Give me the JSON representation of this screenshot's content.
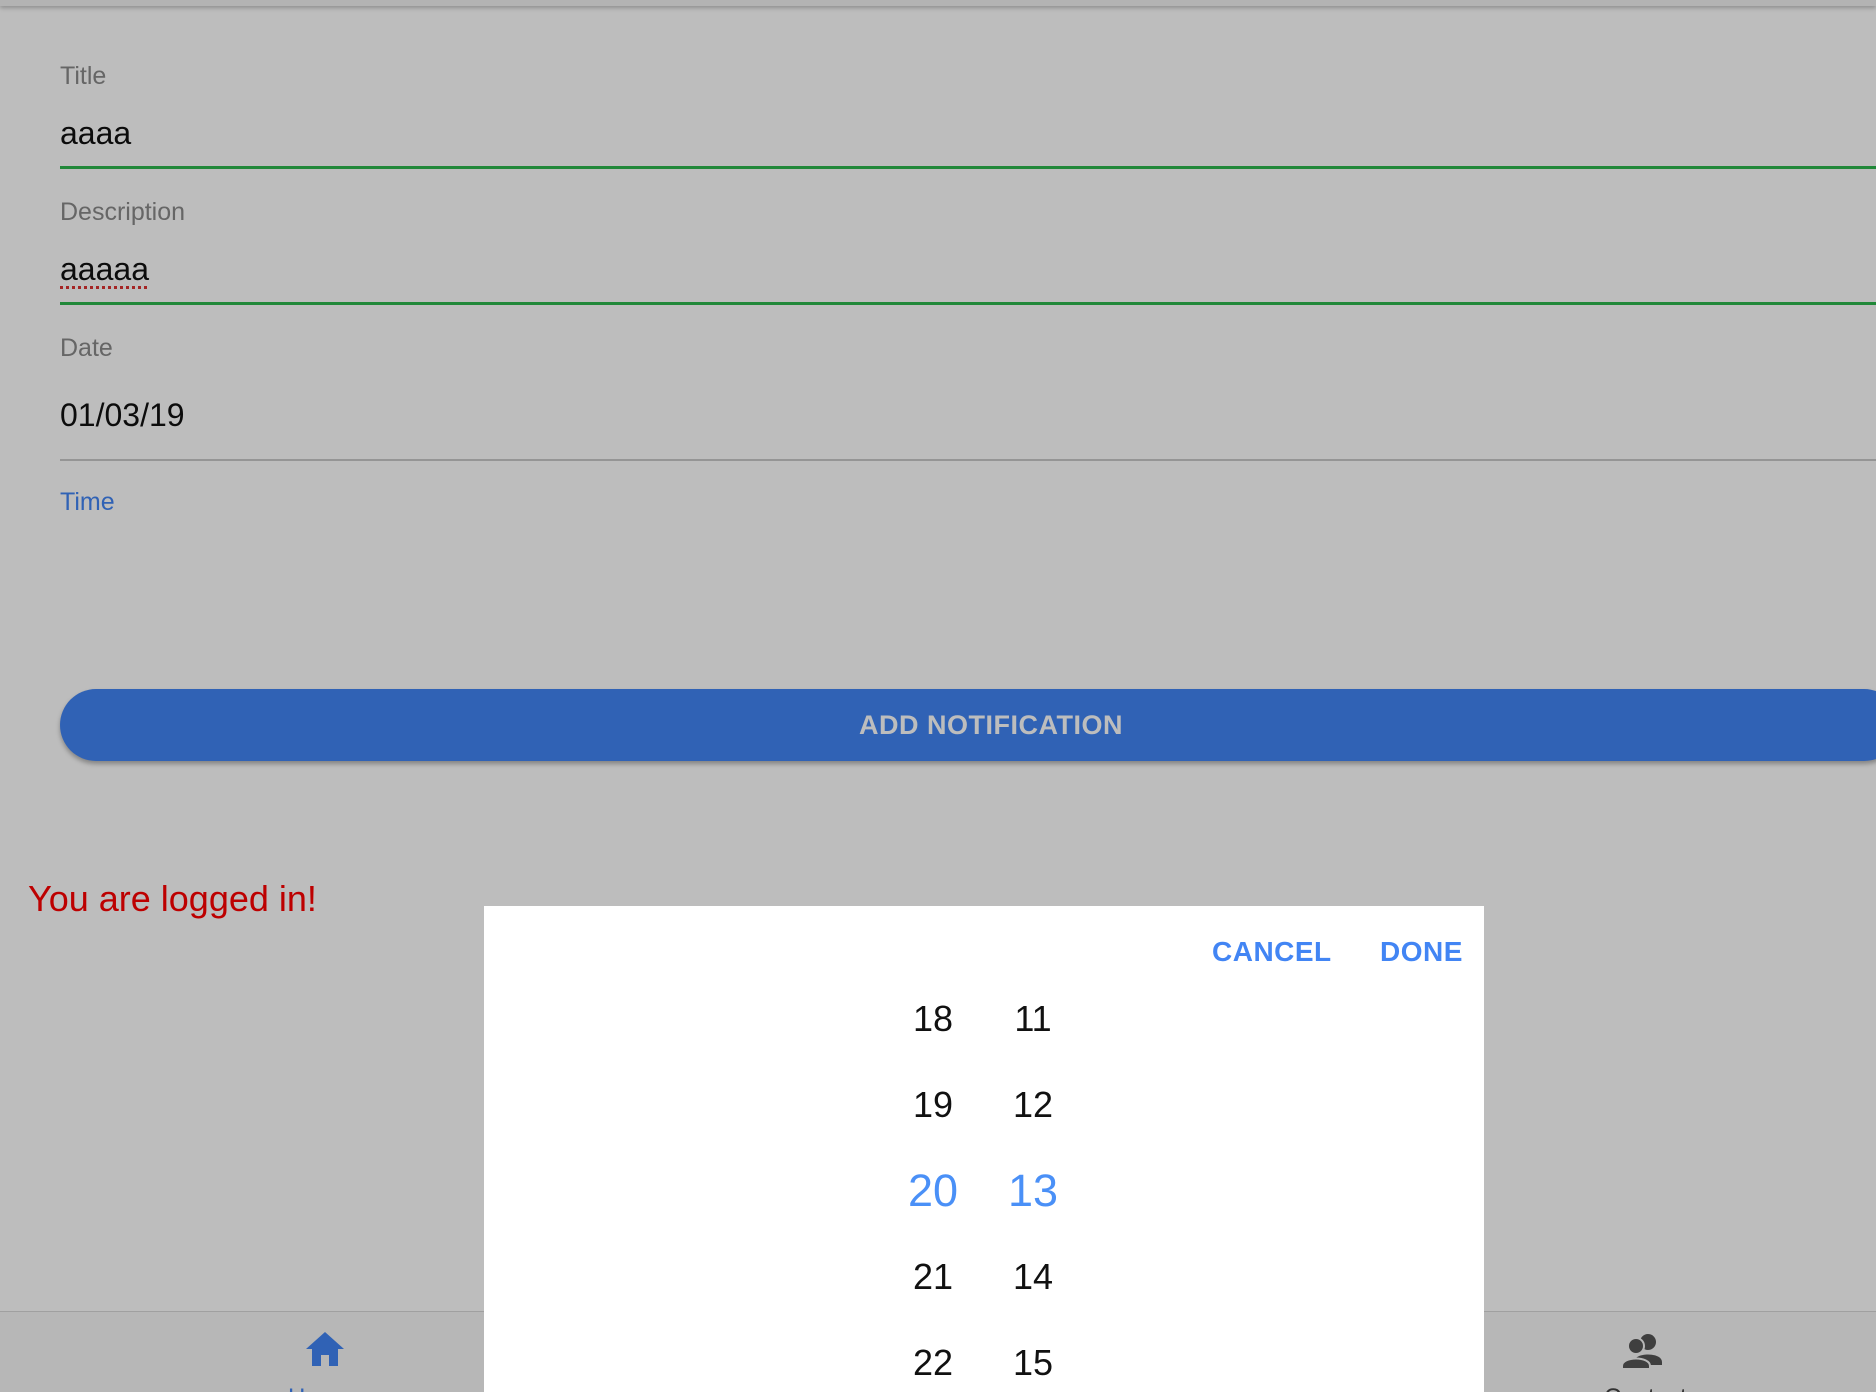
{
  "form": {
    "title": {
      "label": "Title",
      "value": "aaaa"
    },
    "description": {
      "label": "Description",
      "value": "aaaaa"
    },
    "date": {
      "label": "Date",
      "value": "01/03/19"
    },
    "time": {
      "label": "Time"
    }
  },
  "add_button_label": "ADD NOTIFICATION",
  "status_message": "You are logged in!",
  "bottom_nav": {
    "items": [
      {
        "label": "Home",
        "icon": "home-icon",
        "active": true
      },
      {
        "label": "Contacts",
        "icon": "contacts-icon",
        "active": false
      }
    ]
  },
  "time_picker": {
    "cancel_label": "CANCEL",
    "done_label": "DONE",
    "hours": [
      "18",
      "19",
      "20",
      "21",
      "22"
    ],
    "minutes": [
      "11",
      "12",
      "13",
      "14",
      "15"
    ],
    "selected_hour": "20",
    "selected_minute": "13"
  },
  "colors": {
    "accent": "#4285f4",
    "valid_underline": "#2db84d",
    "error_text": "#ff0000"
  }
}
